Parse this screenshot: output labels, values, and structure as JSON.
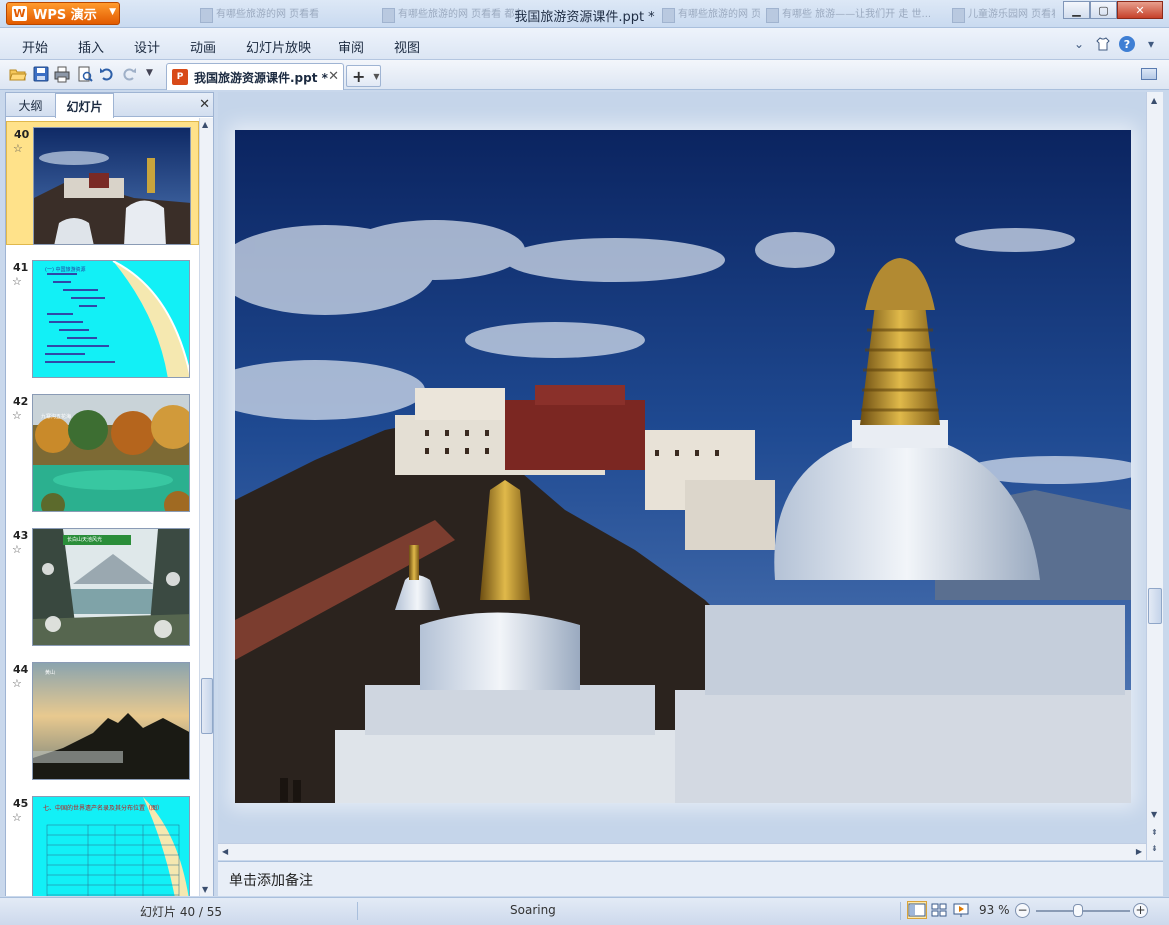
{
  "window": {
    "app_button": "WPS 演示",
    "title": "我国旅游资源课件.ppt *",
    "background_tabs": [
      "有哪些旅游的网 页看看",
      "有哪些旅游的网 页看看 都在 哪里看看呀 有什",
      "有哪些旅游的网 页看看 推荐 有什",
      "有哪些 旅游——让我们开 走 世...",
      "儿童游乐园网 页看看"
    ]
  },
  "menu": {
    "items": [
      "开始",
      "插入",
      "设计",
      "动画",
      "幻灯片放映",
      "审阅",
      "视图"
    ]
  },
  "toolbar": {
    "doc_tab": "我国旅游资源课件.ppt *",
    "new_tab_symbol": "+",
    "icons": [
      "open-folder-icon",
      "save-icon",
      "print-icon",
      "print-preview-icon",
      "undo-icon",
      "redo-icon",
      "customize-icon"
    ]
  },
  "left_panel": {
    "tabs": [
      "大纲",
      "幻灯片"
    ],
    "active_tab": "幻灯片",
    "slides": [
      {
        "num": "40",
        "selected": true,
        "kind": "photo-palace",
        "caption": ""
      },
      {
        "num": "41",
        "selected": false,
        "kind": "cyan-text",
        "caption": "(一) 中国旅游资源"
      },
      {
        "num": "42",
        "selected": false,
        "kind": "photo-forest",
        "caption": "九寨沟五花海"
      },
      {
        "num": "43",
        "selected": false,
        "kind": "photo-snow",
        "caption": "长白山天池风光"
      },
      {
        "num": "44",
        "selected": false,
        "kind": "photo-sunset",
        "caption": "黄山"
      },
      {
        "num": "45",
        "selected": false,
        "kind": "cyan-table",
        "caption": "七、中国的世界遗产名录及其分布位置（图）"
      }
    ]
  },
  "notes": {
    "placeholder": "单击添加备注"
  },
  "status": {
    "slide_info": "幻灯片 40 / 55",
    "theme": "Soaring",
    "zoom": "93 %",
    "zoom_fraction": 0.45
  },
  "colors": {
    "accent": "#e25a00",
    "selection": "#ffe28a",
    "chrome": "#c9d8ec"
  }
}
